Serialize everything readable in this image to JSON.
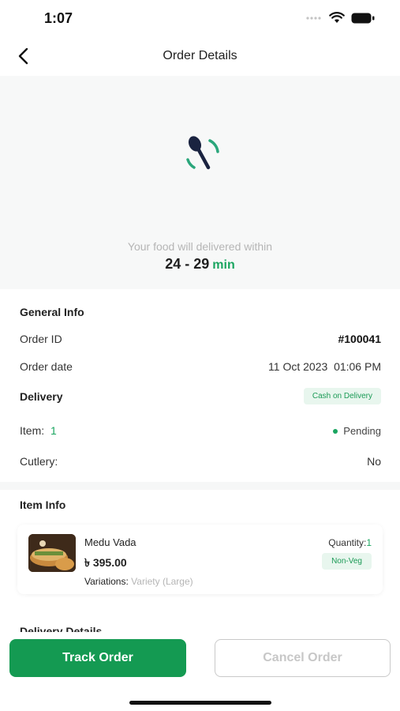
{
  "status_bar": {
    "time": "1:07"
  },
  "header": {
    "title": "Order Details"
  },
  "hero": {
    "message": "Your food will delivered within",
    "time_range": "24 - 29",
    "time_unit": "min"
  },
  "general_info": {
    "title": "General Info",
    "order_id_label": "Order ID",
    "order_id_value": "#100041",
    "order_date_label": "Order date",
    "order_date_value": "11 Oct 2023  01:06 PM",
    "delivery_label": "Delivery",
    "payment_badge": "Cash on Delivery",
    "item_label": "Item:",
    "item_count": "1",
    "status": "Pending",
    "cutlery_label": "Cutlery:",
    "cutlery_value": "No"
  },
  "item_info": {
    "title": "Item Info",
    "item": {
      "name": "Medu Vada",
      "price": "৳ 395.00",
      "variations_label": "Variations:",
      "variations_value": "Variety (Large)",
      "quantity_label": "Quantity:",
      "quantity_value": "1",
      "type_badge": "Non-Veg"
    }
  },
  "next_section_title": "Delivery Details",
  "actions": {
    "track": "Track Order",
    "cancel": "Cancel Order"
  },
  "colors": {
    "accent": "#149a52",
    "badge_bg": "#e8f6ee",
    "muted_text": "#b5b5b5"
  },
  "icons": [
    "back-arrow-icon",
    "wifi-icon",
    "battery-icon",
    "signal-icon",
    "spoon-loading-icon"
  ]
}
